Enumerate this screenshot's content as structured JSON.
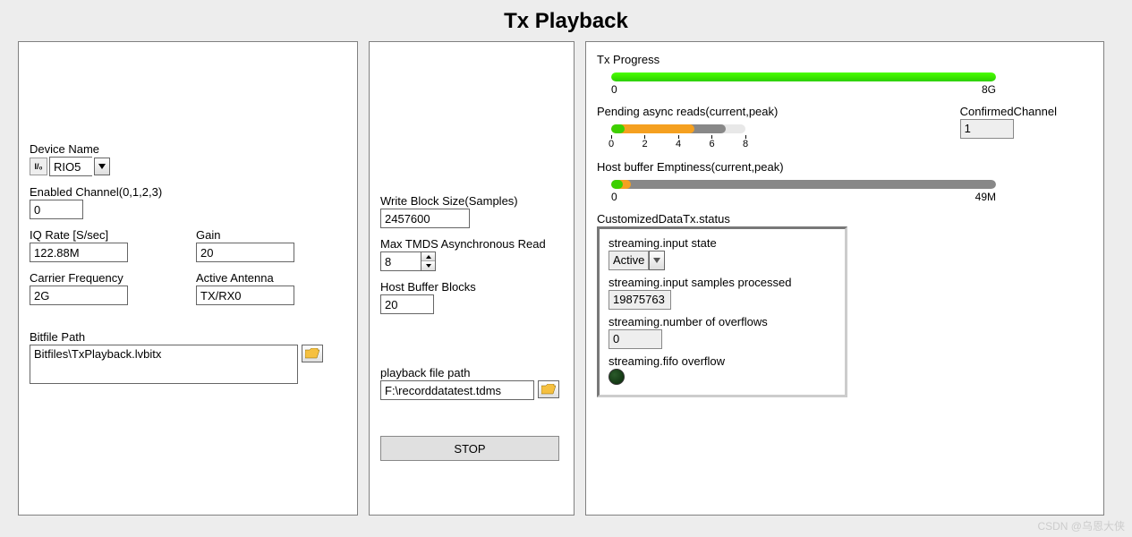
{
  "title": "Tx Playback",
  "panel1": {
    "device_name_label": "Device Name",
    "device_name": "RIO5",
    "enabled_channel_label": "Enabled Channel(0,1,2,3)",
    "enabled_channel": "0",
    "iq_rate_label": "IQ Rate [S/sec]",
    "iq_rate": "122.88M",
    "gain_label": "Gain",
    "gain": "20",
    "carrier_freq_label": "Carrier Frequency",
    "carrier_freq": "2G",
    "active_antenna_label": "Active Antenna",
    "active_antenna": "TX/RX0",
    "bitfile_label": "Bitfile Path",
    "bitfile": "Bitfiles\\TxPlayback.lvbitx"
  },
  "panel2": {
    "write_block_label": "Write Block Size(Samples)",
    "write_block": "2457600",
    "max_tdms_label": "Max TMDS Asynchronous Read",
    "max_tdms": "8",
    "host_buffer_label": "Host Buffer Blocks",
    "host_buffer": "20",
    "playback_path_label": "playback file path",
    "playback_path": "F:\\recorddatatest.tdms",
    "stop_label": "STOP"
  },
  "panel3": {
    "tx_progress_label": "Tx Progress",
    "tx_progress_min": "0",
    "tx_progress_max": "8G",
    "pending_label": "Pending async reads(current,peak)",
    "pending_ticks": [
      "0",
      "2",
      "4",
      "6",
      "8"
    ],
    "confirmed_channel_label": "ConfirmedChannel",
    "confirmed_channel": "1",
    "host_emptiness_label": "Host buffer Emptiness(current,peak)",
    "host_emptiness_min": "0",
    "host_emptiness_max": "49M",
    "status_title": "CustomizedDataTx.status",
    "input_state_label": "streaming.input state",
    "input_state": "Active",
    "samples_processed_label": "streaming.input samples processed",
    "samples_processed": "19875763",
    "overflows_label": "streaming.number of overflows",
    "overflows": "0",
    "fifo_overflow_label": "streaming.fifo overflow"
  },
  "watermark": "CSDN @乌恩大侠",
  "chart_data": [
    {
      "type": "bar",
      "title": "Tx Progress",
      "categories": [
        "progress"
      ],
      "values": [
        8
      ],
      "xlim": [
        0,
        8
      ],
      "unit": "G"
    },
    {
      "type": "bar",
      "title": "Pending async reads(current,peak)",
      "categories": [
        "current",
        "peak"
      ],
      "values": [
        5,
        6.8
      ],
      "xlim": [
        0,
        8
      ]
    },
    {
      "type": "bar",
      "title": "Host buffer Emptiness(current,peak)",
      "categories": [
        "current",
        "peak"
      ],
      "values": [
        2,
        49
      ],
      "xlim": [
        0,
        49
      ],
      "unit": "M"
    }
  ]
}
